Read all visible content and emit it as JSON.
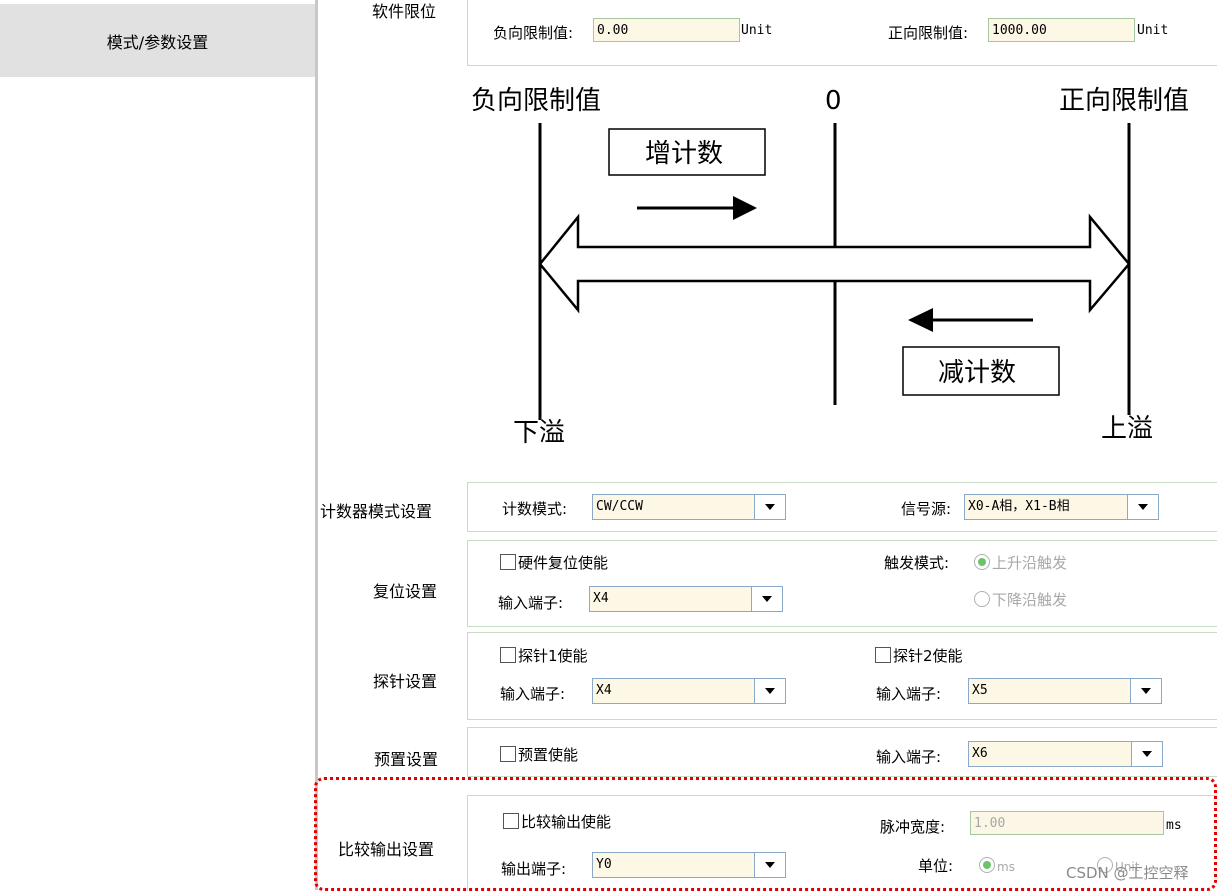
{
  "sidebar": {
    "items": [
      {
        "label": "模式/参数设置"
      }
    ]
  },
  "soft_limit": {
    "section_label": "软件限位",
    "neg_label": "负向限制值:",
    "neg_value": "0.00",
    "neg_unit": "Unit",
    "pos_label": "正向限制值:",
    "pos_value": "1000.00",
    "pos_unit": "Unit"
  },
  "diagram": {
    "neg_limit": "负向限制值",
    "zero": "0",
    "pos_limit": "正向限制值",
    "count_up": "增计数",
    "count_down": "减计数",
    "underflow": "下溢",
    "overflow": "上溢"
  },
  "counter_mode": {
    "section_label": "计数器模式设置",
    "mode_label": "计数模式:",
    "mode_value": "CW/CCW",
    "source_label": "信号源:",
    "source_value": "X0-A相，X1-B相"
  },
  "reset": {
    "section_label": "复位设置",
    "hw_enable": "硬件复位使能",
    "input_label": "输入端子:",
    "input_value": "X4",
    "trigger_label": "触发模式:",
    "rising": "上升沿触发",
    "falling": "下降沿触发"
  },
  "probe": {
    "section_label": "探针设置",
    "probe1_enable": "探针1使能",
    "probe2_enable": "探针2使能",
    "input1_label": "输入端子:",
    "input1_value": "X4",
    "input2_label": "输入端子:",
    "input2_value": "X5"
  },
  "preset": {
    "section_label": "预置设置",
    "enable": "预置使能",
    "input_label": "输入端子:",
    "input_value": "X6"
  },
  "compare": {
    "section_label": "比较输出设置",
    "enable": "比较输出使能",
    "pulse_label": "脉冲宽度:",
    "pulse_value": "1.00",
    "pulse_unit": "ms",
    "output_label": "输出端子:",
    "output_value": "Y0",
    "unit_label": "单位:",
    "unit_ms": "ms",
    "unit_unit": "Unit"
  },
  "watermark": "CSDN @工控空释"
}
